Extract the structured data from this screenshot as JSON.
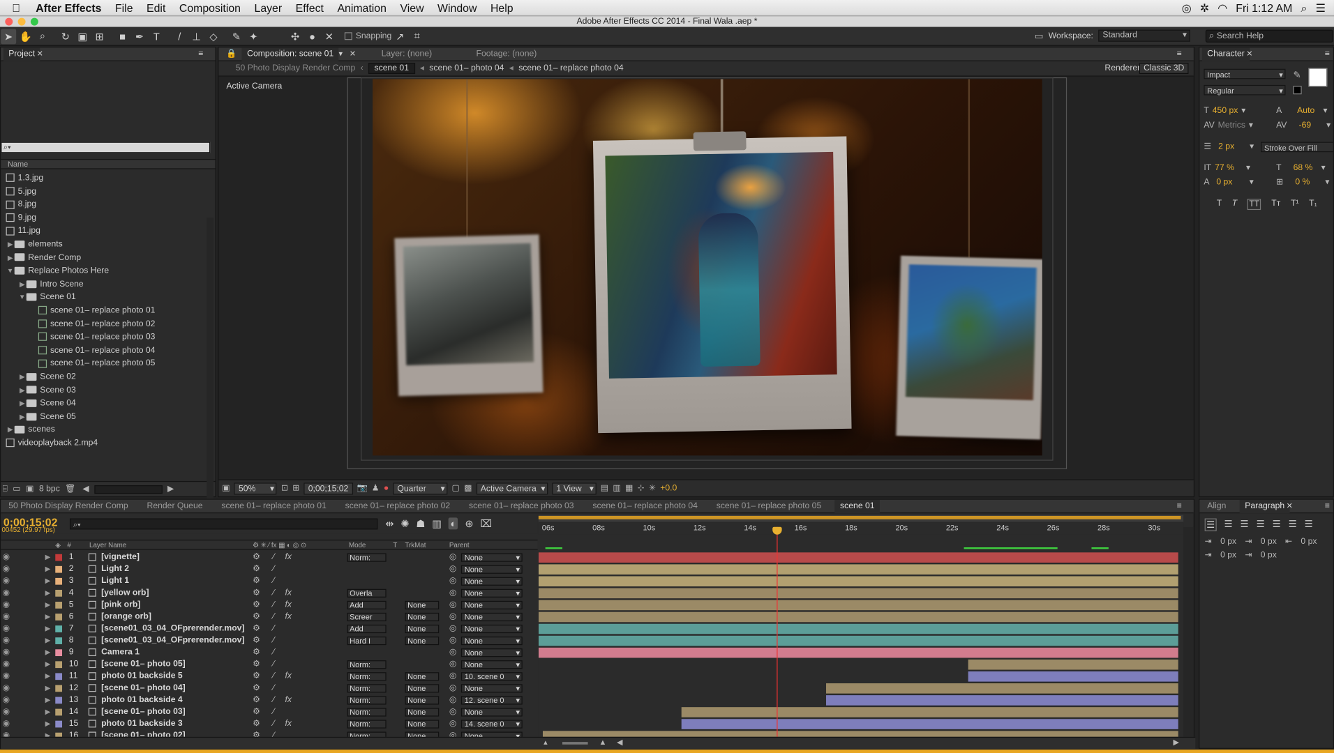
{
  "menubar": {
    "app": "After Effects",
    "items": [
      "File",
      "Edit",
      "Composition",
      "Layer",
      "Effect",
      "Animation",
      "View",
      "Window",
      "Help"
    ],
    "clock": "Fri 1:12 AM"
  },
  "titlebar": {
    "title": "Adobe After Effects CC 2014 - Final Wala .aep *"
  },
  "toolbar": {
    "snapping": "Snapping",
    "workspace_label": "Workspace:",
    "workspace_value": "Standard",
    "search_placeholder": "Search Help"
  },
  "project": {
    "title": "Project",
    "name_header": "Name",
    "items": [
      {
        "label": "1.3.jpg",
        "type": "file",
        "depth": 0
      },
      {
        "label": "5.jpg",
        "type": "file",
        "depth": 0
      },
      {
        "label": "8.jpg",
        "type": "file",
        "depth": 0
      },
      {
        "label": "9.jpg",
        "type": "file",
        "depth": 0
      },
      {
        "label": "11.jpg",
        "type": "file",
        "depth": 0
      },
      {
        "label": "elements",
        "type": "folder",
        "depth": 0
      },
      {
        "label": "Render Comp",
        "type": "folder",
        "depth": 0
      },
      {
        "label": "Replace Photos Here",
        "type": "folder-open",
        "depth": 0
      },
      {
        "label": "Intro Scene",
        "type": "folder",
        "depth": 1
      },
      {
        "label": "Scene 01",
        "type": "folder-open",
        "depth": 1
      },
      {
        "label": "scene 01– replace photo 01",
        "type": "comp",
        "depth": 2
      },
      {
        "label": "scene 01– replace photo 02",
        "type": "comp",
        "depth": 2
      },
      {
        "label": "scene 01– replace photo 03",
        "type": "comp",
        "depth": 2
      },
      {
        "label": "scene 01– replace photo 04",
        "type": "comp",
        "depth": 2
      },
      {
        "label": "scene 01– replace photo 05",
        "type": "comp",
        "depth": 2
      },
      {
        "label": "Scene 02",
        "type": "folder",
        "depth": 1
      },
      {
        "label": "Scene 03",
        "type": "folder",
        "depth": 1
      },
      {
        "label": "Scene 04",
        "type": "folder",
        "depth": 1
      },
      {
        "label": "Scene 05",
        "type": "folder",
        "depth": 1
      },
      {
        "label": "scenes",
        "type": "folder",
        "depth": 0
      },
      {
        "label": "videoplayback 2.mp4",
        "type": "file",
        "depth": 0
      }
    ],
    "bpc": "8 bpc"
  },
  "viewer": {
    "tab_comp": "Composition: scene 01",
    "tab_layer": "Layer: (none)",
    "tab_footage": "Footage: (none)",
    "breadcrumbs": [
      "50 Photo Display Render Comp",
      "scene 01",
      "scene 01– photo 04",
      "scene 01– replace photo 04"
    ],
    "renderer_label": "Renderer:",
    "renderer_value": "Classic 3D",
    "active_camera_label": "Active Camera",
    "zoom": "50%",
    "timecode": "0;00;15;02",
    "resolution": "Quarter",
    "camera": "Active Camera",
    "views": "1 View",
    "exposure": "+0.0"
  },
  "character": {
    "title": "Character",
    "font": "Impact",
    "style": "Regular",
    "size": "450 px",
    "leading": "Auto",
    "kerning": "Metrics",
    "tracking": "-69",
    "stroke_width": "2 px",
    "stroke_mode": "Stroke Over Fill",
    "vscale": "77 %",
    "hscale": "68 %",
    "baseline": "0 px",
    "tsume": "0 %",
    "fill_color": "#ffffff",
    "stroke_color": "#000000"
  },
  "paragraph": {
    "tabs": [
      "Align",
      "Paragraph"
    ],
    "indent_left": "0 px",
    "indent_first": "0 px",
    "indent_right": "0 px",
    "space_before": "0 px",
    "space_after": "0 px"
  },
  "timeline": {
    "tabs": [
      "50 Photo Display Render Comp",
      "Render Queue",
      "scene 01– replace photo 01",
      "scene 01– replace photo 02",
      "scene 01– replace photo 03",
      "scene 01– replace photo 04",
      "scene 01– replace photo 05",
      "scene 01"
    ],
    "active_tab": "scene 01",
    "timecode": "0;00;15;02",
    "frames": "00452 (29.97 fps)",
    "columns": {
      "num": "#",
      "name": "Layer Name",
      "mode": "Mode",
      "t": "T",
      "trkmat": "TrkMat",
      "parent": "Parent"
    },
    "ruler": [
      "06s",
      "08s",
      "10s",
      "12s",
      "14s",
      "16s",
      "18s",
      "20s",
      "22s",
      "24s",
      "26s",
      "28s",
      "30s"
    ],
    "layers": [
      {
        "num": "1",
        "name": "[vignette]",
        "color": "#c23a3a",
        "mode": "Norm:",
        "trkmat": "",
        "parent": "None",
        "bar": "#b84a4a",
        "start": 0.0,
        "end": 1.0,
        "fx": true
      },
      {
        "num": "2",
        "name": "Light 2",
        "color": "#e6b07a",
        "mode": "",
        "trkmat": "",
        "parent": "None",
        "bar": "#b2a070",
        "start": 0.0,
        "end": 1.0,
        "fx": false
      },
      {
        "num": "3",
        "name": "Light 1",
        "color": "#e6b07a",
        "mode": "",
        "trkmat": "",
        "parent": "None",
        "bar": "#b2a070",
        "start": 0.0,
        "end": 1.0,
        "fx": false
      },
      {
        "num": "4",
        "name": "[yellow orb]",
        "color": "#b8a070",
        "mode": "Overla",
        "trkmat": "",
        "parent": "None",
        "bar": "#9b8a66",
        "start": 0.0,
        "end": 1.0,
        "fx": true
      },
      {
        "num": "5",
        "name": "[pink orb]",
        "color": "#b8a070",
        "mode": "Add",
        "trkmat": "None",
        "parent": "None",
        "bar": "#9b8a66",
        "start": 0.0,
        "end": 1.0,
        "fx": true
      },
      {
        "num": "6",
        "name": "[orange orb]",
        "color": "#b8a070",
        "mode": "Screer",
        "trkmat": "None",
        "parent": "None",
        "bar": "#9b8a66",
        "start": 0.0,
        "end": 1.0,
        "fx": true
      },
      {
        "num": "7",
        "name": "[scene01_03_04_OFprerender.mov]",
        "color": "#5fb0a8",
        "mode": "Add",
        "trkmat": "None",
        "parent": "None",
        "bar": "#5c9e98",
        "start": 0.0,
        "end": 1.0,
        "fx": false
      },
      {
        "num": "8",
        "name": "[scene01_03_04_OFprerender.mov]",
        "color": "#5fb0a8",
        "mode": "Hard I",
        "trkmat": "None",
        "parent": "None",
        "bar": "#5c9e98",
        "start": 0.0,
        "end": 1.0,
        "fx": false
      },
      {
        "num": "9",
        "name": "Camera 1",
        "color": "#e88ea0",
        "mode": "",
        "trkmat": "",
        "parent": "None",
        "bar": "#d27c8e",
        "start": 0.0,
        "end": 1.0,
        "fx": false
      },
      {
        "num": "10",
        "name": "[scene 01– photo 05]",
        "color": "#b8a070",
        "mode": "Norm:",
        "trkmat": "",
        "parent": "None",
        "bar": "#9b8a66",
        "start": 0.672,
        "end": 1.0,
        "fx": false
      },
      {
        "num": "11",
        "name": "photo 01 backside 5",
        "color": "#8a8ac8",
        "mode": "Norm:",
        "trkmat": "None",
        "parent": "10. scene 0",
        "bar": "#7e7ebc",
        "start": 0.672,
        "end": 1.0,
        "fx": true
      },
      {
        "num": "12",
        "name": "[scene 01– photo 04]",
        "color": "#b8a070",
        "mode": "Norm:",
        "trkmat": "None",
        "parent": "None",
        "bar": "#9b8a66",
        "start": 0.449,
        "end": 1.0,
        "fx": false
      },
      {
        "num": "13",
        "name": "photo 01 backside 4",
        "color": "#8a8ac8",
        "mode": "Norm:",
        "trkmat": "None",
        "parent": "12. scene 0",
        "bar": "#7e7ebc",
        "start": 0.449,
        "end": 1.0,
        "fx": true
      },
      {
        "num": "14",
        "name": "[scene 01– photo 03]",
        "color": "#b8a070",
        "mode": "Norm:",
        "trkmat": "None",
        "parent": "None",
        "bar": "#9b8a66",
        "start": 0.224,
        "end": 1.0,
        "fx": false
      },
      {
        "num": "15",
        "name": "photo 01 backside 3",
        "color": "#8a8ac8",
        "mode": "Norm:",
        "trkmat": "None",
        "parent": "14. scene 0",
        "bar": "#7e7ebc",
        "start": 0.224,
        "end": 1.0,
        "fx": true
      },
      {
        "num": "16",
        "name": "[scene 01– photo 02]",
        "color": "#b8a070",
        "mode": "Norm:",
        "trkmat": "None",
        "parent": "None",
        "bar": "#9b8a66",
        "start": 0.006,
        "end": 1.0,
        "fx": false
      }
    ],
    "playhead_fraction": 0.37
  }
}
